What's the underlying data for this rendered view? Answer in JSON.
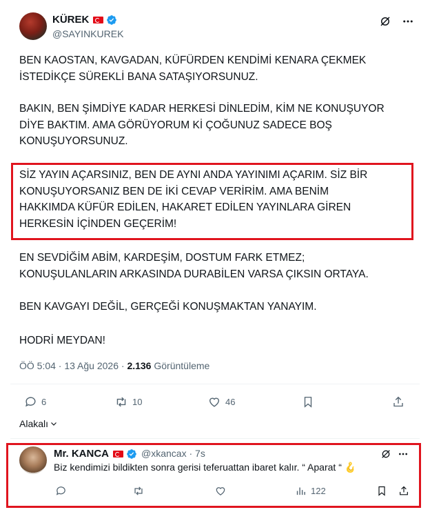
{
  "tweet": {
    "author_name": "KÜREK",
    "author_handle": "@SAYINKUREK",
    "paragraphs": [
      [
        "BEN KAOSTAN, KAVGADAN, KÜFÜRDEN KENDİMİ KENARA ÇEKMEK",
        "İSTEDİKÇE SÜREKLİ BANA SATAŞIYORSUNUZ."
      ],
      [
        "BAKIN, BEN ŞİMDİYE KADAR HERKESİ DİNLEDİM, KİM NE KONUŞUYOR",
        "DİYE BAKTIM. AMA GÖRÜYORUM Kİ ÇOĞUNUZ SADECE BOŞ",
        "KONUŞUYORSUNUZ."
      ],
      [
        "SİZ YAYIN AÇARSINIZ, BEN DE AYNI ANDA YAYINIMI AÇARIM. SİZ BİR",
        "KONUŞUYORSANIZ BEN DE İKİ CEVAP VERİRİM. AMA BENİM",
        "HAKKIMDA KÜFÜR EDİLEN, HAKARET EDİLEN YAYINLARA GİREN",
        "HERKESİN İÇİNDEN GEÇERİM!"
      ],
      [
        "EN SEVDİĞİM ABİM, KARDEŞİM, DOSTUM FARK ETMEZ;",
        "KONUŞULANLARIN ARKASINDA DURABİLEN VARSA ÇIKSIN ORTAYA."
      ],
      [
        "BEN KAVGAYI DEĞİL, GERÇEĞİ KONUŞMAKTAN YANAYIM."
      ],
      [
        "HODRİ MEYDAN!"
      ]
    ],
    "time": "ÖÖ 5:04 · 13 Ağu 2026 ·",
    "views_count": "2.136",
    "views_label": "Görüntüleme",
    "replies": "6",
    "retweets": "10",
    "likes": "46",
    "related_label": "Alakalı"
  },
  "reply": {
    "author_name": "Mr. KANCA",
    "author_handle": "@xkancax · 7s",
    "text": "Biz kendimizi bildikten sonra gerisi teferuattan ibaret kalır.  “ Aparat “",
    "emoji": "🪝",
    "views": "122"
  },
  "colors": {
    "highlight_box": "#e0141e",
    "verified": "#1d9bf0",
    "muted_text": "#536471",
    "flag_red": "#e30a17"
  },
  "icons": [
    "verified-badge-icon",
    "grok-icon",
    "more-icon",
    "reply-icon",
    "retweet-icon",
    "like-icon",
    "bookmark-icon",
    "share-icon",
    "views-icon",
    "chevron-down-icon"
  ]
}
